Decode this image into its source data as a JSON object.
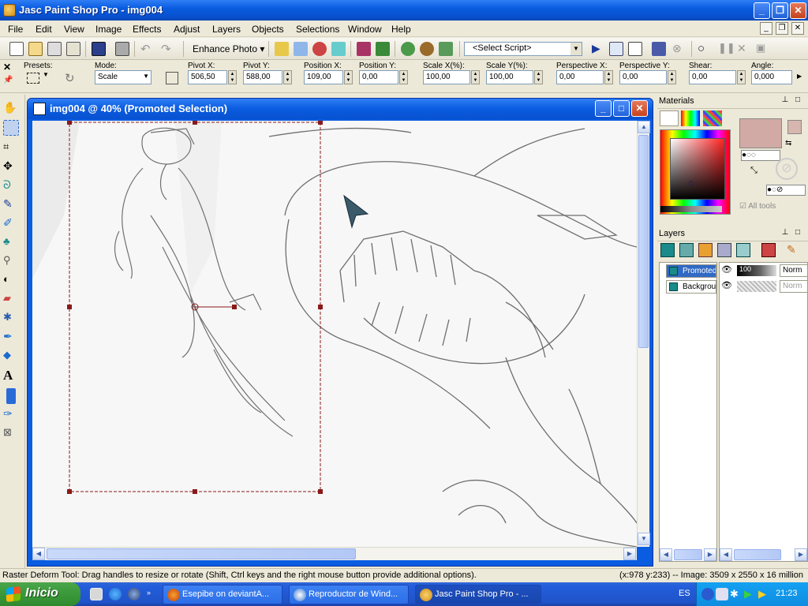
{
  "window": {
    "title": "Jasc Paint Shop Pro - img004"
  },
  "menu": [
    "File",
    "Edit",
    "View",
    "Image",
    "Effects",
    "Adjust",
    "Layers",
    "Objects",
    "Selections",
    "Window",
    "Help"
  ],
  "toolbar": {
    "enhance_label": "Enhance Photo",
    "script_select": "<Select Script>"
  },
  "options": {
    "presets_label": "Presets:",
    "mode_label": "Mode:",
    "mode_value": "Scale",
    "pivot_x_label": "Pivot X:",
    "pivot_x": "506,50",
    "pivot_y_label": "Pivot Y:",
    "pivot_y": "588,00",
    "pos_x_label": "Position X:",
    "pos_x": "109,00",
    "pos_y_label": "Position Y:",
    "pos_y": "0,00",
    "scale_x_label": "Scale X(%):",
    "scale_x": "100,00",
    "scale_y_label": "Scale Y(%):",
    "scale_y": "100,00",
    "persp_x_label": "Perspective X:",
    "persp_x": "0,00",
    "persp_y_label": "Perspective Y:",
    "persp_y": "0,00",
    "shear_label": "Shear:",
    "shear": "0,00",
    "angle_label": "Angle:",
    "angle": "0,000"
  },
  "document": {
    "title": "img004 @  40% (Promoted Selection)"
  },
  "materials": {
    "title": "Materials",
    "all_tools": "All tools",
    "fg_color": "#d2aaa5"
  },
  "layers": {
    "title": "Layers",
    "rows": [
      {
        "name": "Promoted",
        "opacity": "100",
        "blend": "Norm"
      },
      {
        "name": "Background",
        "opacity": "",
        "blend": "Norm"
      }
    ]
  },
  "status": {
    "hint": "Raster Deform Tool: Drag handles to resize or rotate (Shift, Ctrl keys and the right mouse button provide additional options).",
    "info": "(x:978 y:233) -- Image:  3509 x 2550 x 16 million"
  },
  "taskbar": {
    "start": "Inicio",
    "tasks": [
      {
        "label": "Esepibe on deviantA...",
        "icon": "firefox-icon"
      },
      {
        "label": "Reproductor de Wind...",
        "icon": "media-player-icon"
      },
      {
        "label": "Jasc Paint Shop Pro - ...",
        "icon": "paint-shop-pro-icon",
        "active": true
      }
    ],
    "lang": "ES",
    "time": "21:23"
  }
}
